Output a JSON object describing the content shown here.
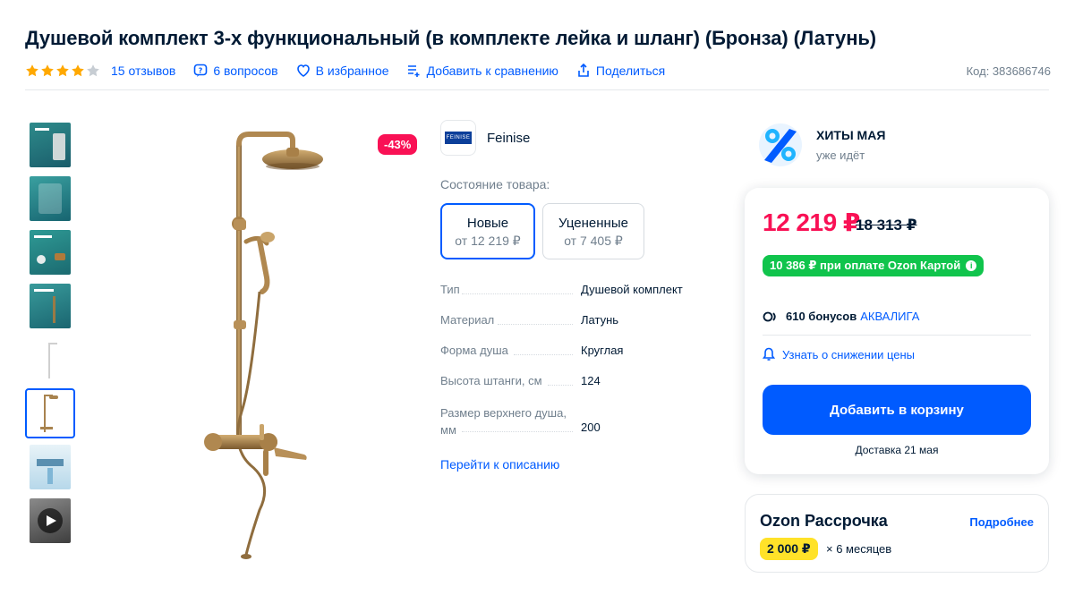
{
  "product": {
    "title": "Душевой комплект 3-х функциональный (в комплекте лейка и шланг) (Бронза) (Латунь)",
    "rating": 4,
    "rating_max": 5,
    "reviews_label": "15 отзывов",
    "questions_label": "6 вопросов",
    "favorite_label": "В избранное",
    "compare_label": "Добавить к сравнению",
    "share_label": "Поделиться",
    "code_label": "Код: 383686746"
  },
  "gallery": {
    "discount_badge": "-43%",
    "active_index": 5,
    "thumbnail_count": 8
  },
  "brand": {
    "logo_text": "FEINISE",
    "name": "Feinise"
  },
  "condition": {
    "label": "Состояние товара:",
    "options": [
      {
        "name": "Новые",
        "price": "от 12 219 ₽"
      },
      {
        "name": "Уцененные",
        "price": "от 7 405 ₽"
      }
    ]
  },
  "specs": [
    {
      "key": "Тип",
      "value": "Душевой комплект"
    },
    {
      "key": "Материал",
      "value": "Латунь"
    },
    {
      "key": "Форма душа",
      "value": "Круглая"
    },
    {
      "key": "Высота штанги, см",
      "value": "124"
    },
    {
      "key": "Размер верхнего душа, мм",
      "value": "200"
    }
  ],
  "description_link": "Перейти к описанию",
  "promo": {
    "title": "ХИТЫ МАЯ",
    "subtitle": "уже идёт"
  },
  "price": {
    "current": "12 219 ₽",
    "old": "18 313 ₽",
    "card_price": "10 386 ₽ при оплате Ozon Картой",
    "bonus_amount": "610 бонусов",
    "bonus_program": "АКВАЛИГА",
    "notify_label": "Узнать о снижении цены",
    "cart_button": "Добавить в корзину",
    "delivery": "Доставка 21 мая"
  },
  "installment": {
    "title": "Ozon Рассрочка",
    "more_label": "Подробнее",
    "amount": "2 000 ₽",
    "term": "× 6 месяцев"
  },
  "colors": {
    "accent": "#005bff",
    "sale": "#f91155",
    "card_green": "#10c44c",
    "installment_yellow": "#ffe229",
    "star": "#ffa800"
  }
}
